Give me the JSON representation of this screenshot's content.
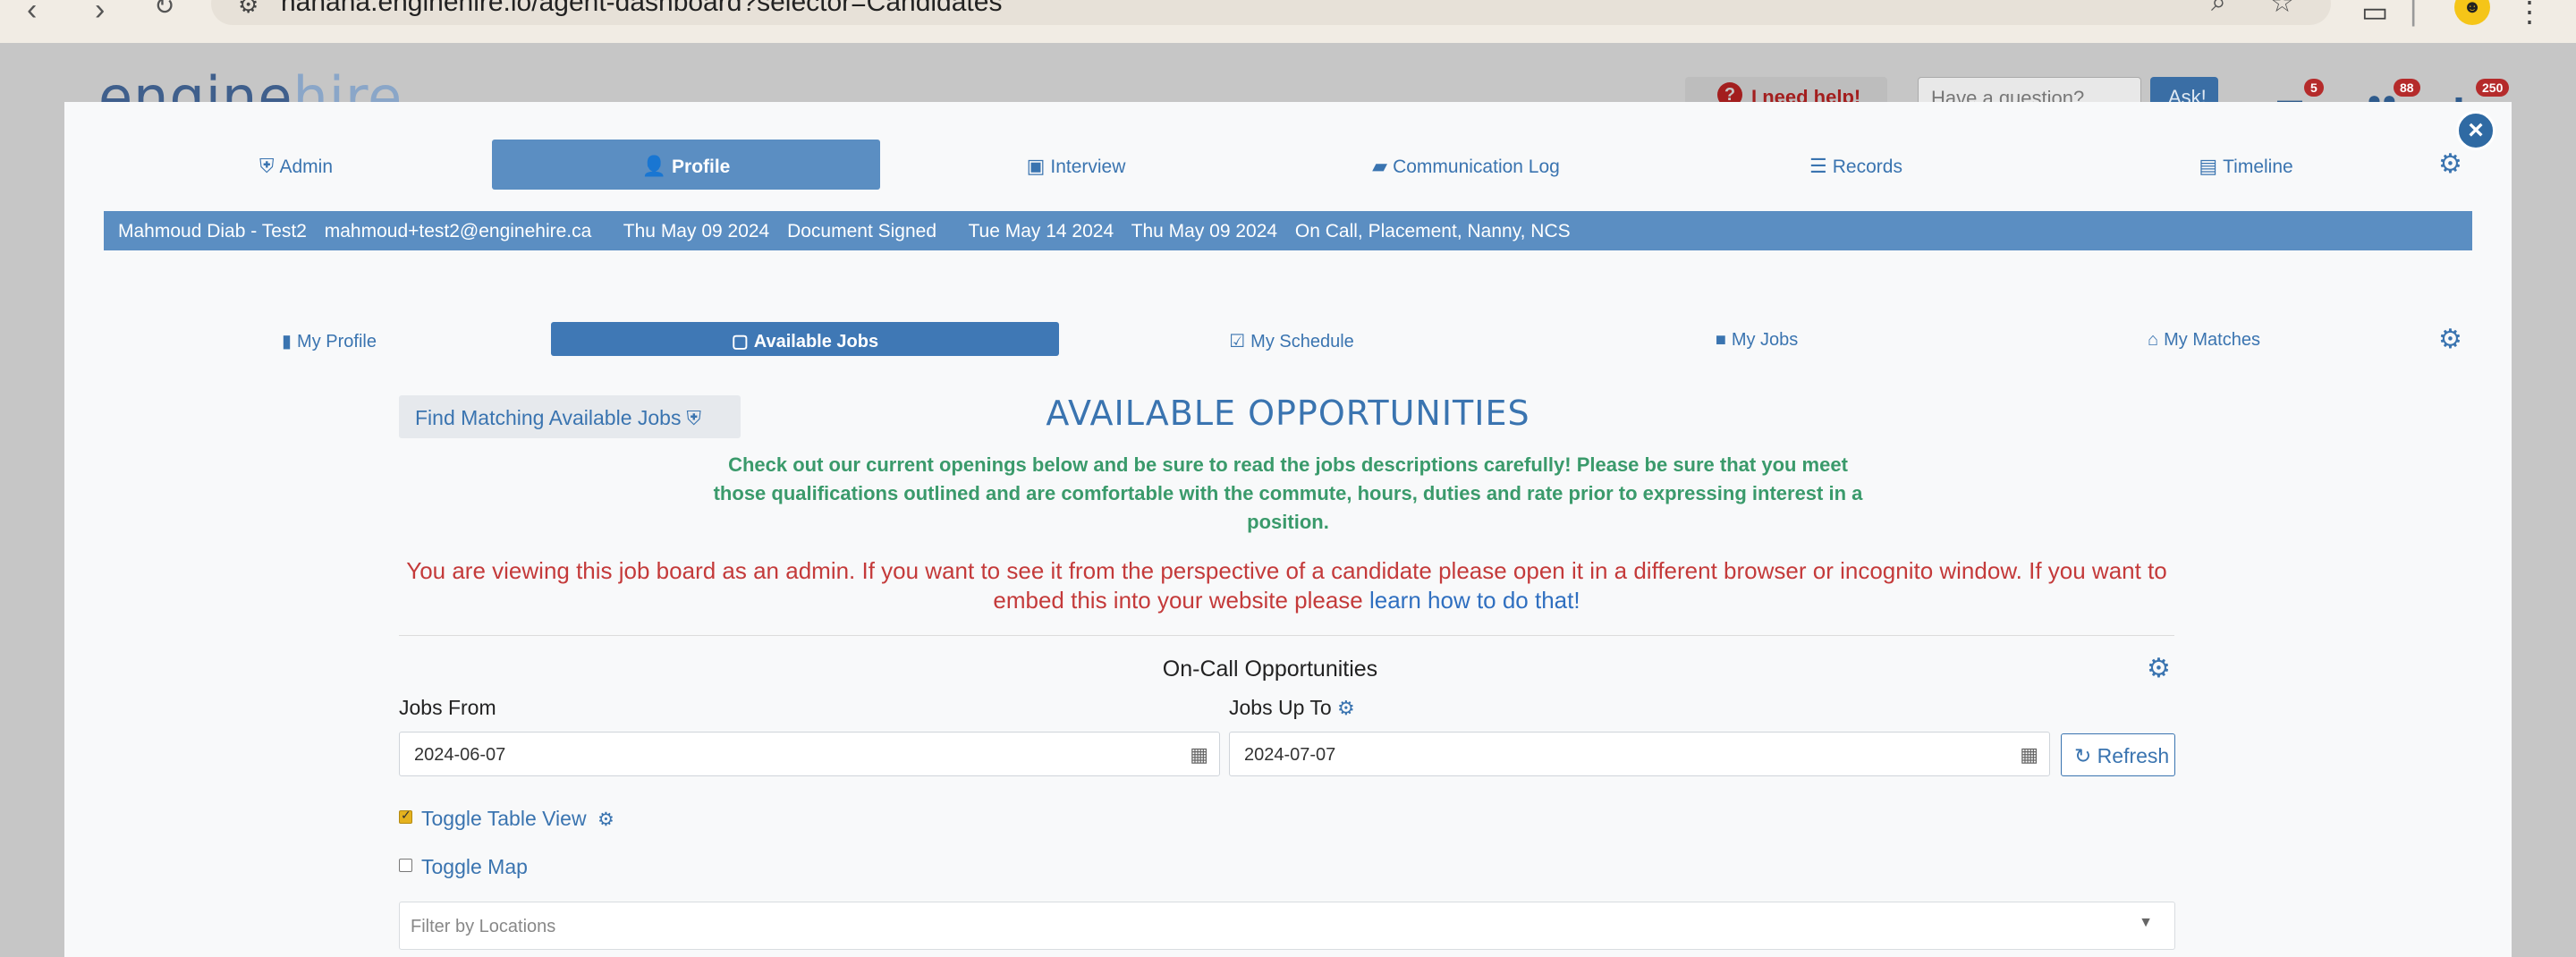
{
  "browser": {
    "url": "nanana.enginehire.io/agent-dashboard?selector=Candidates"
  },
  "background": {
    "logo_main": "engine",
    "logo_accent": "hire",
    "help_label": "I need help!",
    "question_placeholder": "Have a question?",
    "ask_label": "Ask!",
    "badges": [
      "5",
      "88",
      "250"
    ]
  },
  "main_tabs": [
    {
      "label": "Admin",
      "icon": "shield-icon"
    },
    {
      "label": "Profile",
      "icon": "user-icon",
      "active": true
    },
    {
      "label": "Interview",
      "icon": "id-card-icon"
    },
    {
      "label": "Communication Log",
      "icon": "chat-icon"
    },
    {
      "label": "Records",
      "icon": "list-icon"
    },
    {
      "label": "Timeline",
      "icon": "timeline-icon"
    }
  ],
  "infobar": {
    "name": "Mahmoud Diab - Test2",
    "email": "mahmoud+test2@enginehire.ca",
    "date1": "Thu May 09 2024",
    "status": "Document Signed",
    "date2": "Tue May 14 2024",
    "date3": "Thu May 09 2024",
    "tags": "On Call, Placement, Nanny, NCS"
  },
  "sub_tabs": [
    {
      "label": "My Profile",
      "icon": "document-icon"
    },
    {
      "label": "Available Jobs",
      "icon": "briefcase-icon",
      "active": true
    },
    {
      "label": "My Schedule",
      "icon": "calendar-check-icon"
    },
    {
      "label": "My Jobs",
      "icon": "briefcase-icon"
    },
    {
      "label": "My Matches",
      "icon": "home-icon"
    }
  ],
  "content": {
    "find_button": "Find Matching Available Jobs",
    "title": "AVAILABLE OPPORTUNITIES",
    "intro": "Check out our current openings below and be sure to read the jobs descriptions carefully! Please be sure that you meet those qualifications outlined and are comfortable with the commute, hours, duties and rate prior to expressing interest in a position.",
    "admin_note": "You are viewing this job board as an admin. If you want to see it from the perspective of a candidate please open it in a different browser or incognito window. If you want to embed this into your website please",
    "admin_link": "learn how to do that!",
    "section_title": "On-Call Opportunities",
    "jobs_from_label": "Jobs From",
    "jobs_from_value": "2024-06-07",
    "jobs_to_label": "Jobs Up To",
    "jobs_to_value": "2024-07-07",
    "refresh_label": "Refresh",
    "toggle_table": "Toggle Table View",
    "toggle_map": "Toggle Map",
    "filter_placeholder": "Filter by Locations"
  },
  "colors": {
    "primary": "#3a74b0",
    "active_tab": "#5b8ec2",
    "intro_green": "#3a9a6b",
    "warning_red": "#c43a3a"
  }
}
